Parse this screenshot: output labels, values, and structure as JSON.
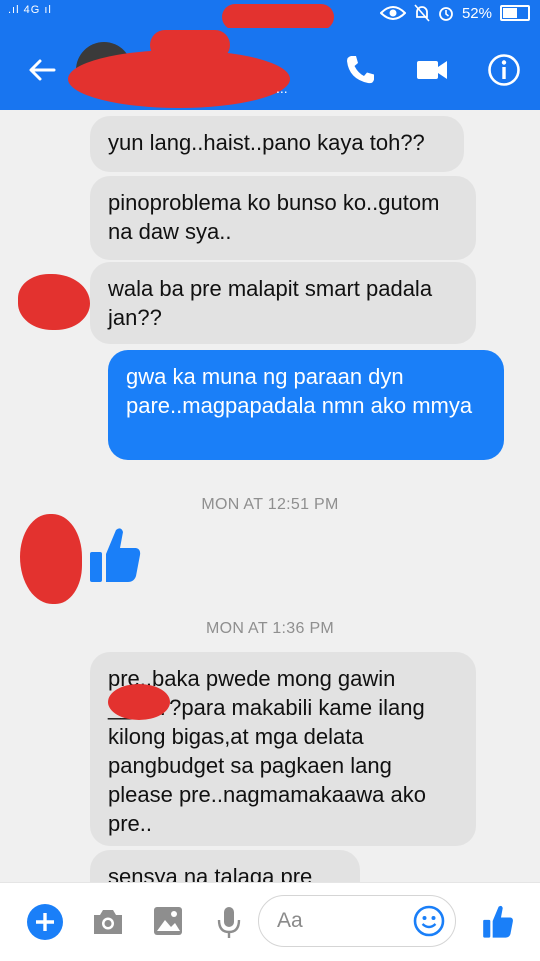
{
  "statusbar": {
    "signal": ".ıl 4G ıl",
    "battery": "52%",
    "battery_level": 0.52
  },
  "header": {
    "subtitle_dots": "..."
  },
  "messages": [
    {
      "id": "m1",
      "direction": "in",
      "text": "yun lang..haist..pano kaya toh??"
    },
    {
      "id": "m2",
      "direction": "in",
      "text": "pinoproblema ko bunso ko..gutom na daw sya.."
    },
    {
      "id": "m3",
      "direction": "in",
      "text": "wala ba pre malapit smart padala jan??"
    },
    {
      "id": "m4",
      "direction": "out",
      "text": "gwa ka muna ng paraan dyn pare..magpapadala nmn ako mmya"
    },
    {
      "id": "t1",
      "type": "timestamp",
      "text": "MON AT 12:51 PM"
    },
    {
      "id": "t2",
      "type": "timestamp",
      "text": "MON AT 1:36 PM"
    },
    {
      "id": "m5",
      "direction": "in",
      "text": "pre..baka pwede mong gawin ___a??para makabili kame ilang kilong bigas,at mga delata pangbudget sa pagkaen lang please pre..nagmamakaawa ako pre.."
    },
    {
      "id": "m6",
      "direction": "in",
      "text": "sensya na talaga pre"
    }
  ],
  "composer": {
    "placeholder": "Aa"
  },
  "colors": {
    "brand": "#1875f0",
    "outgoing": "#1a7ff8",
    "incoming": "#e2e2e2",
    "redaction": "#e3322f"
  },
  "icons": [
    "back-arrow-icon",
    "phone-icon",
    "video-camera-icon",
    "info-icon",
    "like-thumb-icon",
    "plus-icon",
    "camera-icon",
    "image-icon",
    "microphone-icon",
    "emoji-icon"
  ]
}
